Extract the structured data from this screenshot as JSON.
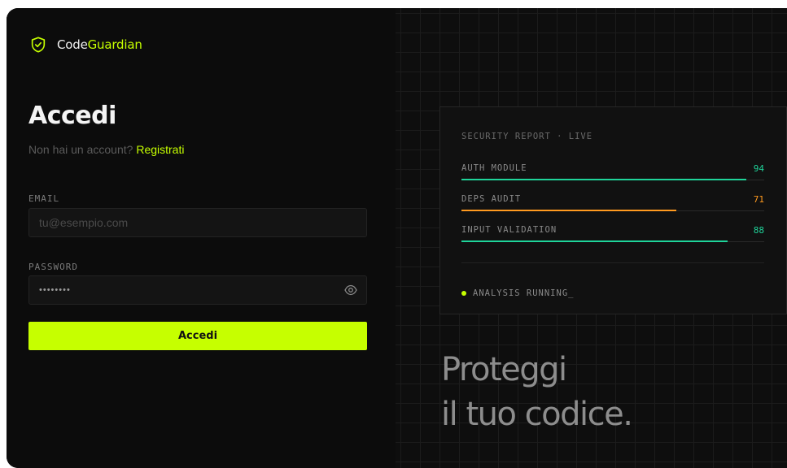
{
  "brand": {
    "name_prefix": "Code",
    "name_accent": "Guardian",
    "icon": "shield-check-icon"
  },
  "login": {
    "title": "Accedi",
    "subtitle_text": "Non hai un account?",
    "register_link": "Registrati",
    "email": {
      "label": "EMAIL",
      "placeholder": "tu@esempio.com",
      "value": ""
    },
    "password": {
      "label": "PASSWORD",
      "value": "••••••••",
      "toggle_icon": "eye-icon"
    },
    "submit_label": "Accedi"
  },
  "report": {
    "title": "SECURITY REPORT · LIVE",
    "metrics": [
      {
        "label": "AUTH MODULE",
        "value": "94",
        "fill_fraction": 0.94,
        "color": "#1fd49a"
      },
      {
        "label": "DEPS AUDIT",
        "value": "71",
        "fill_fraction": 0.71,
        "color": "#ff9a1f"
      },
      {
        "label": "INPUT VALIDATION",
        "value": "88",
        "fill_fraction": 0.88,
        "color": "#1fd49a"
      }
    ],
    "status_text": "ANALYSIS RUNNING_"
  },
  "tagline": {
    "line1": "Proteggi",
    "line2": "il tuo codice."
  },
  "colors": {
    "accent": "#c6ff00",
    "background": "#0c0c0c"
  }
}
